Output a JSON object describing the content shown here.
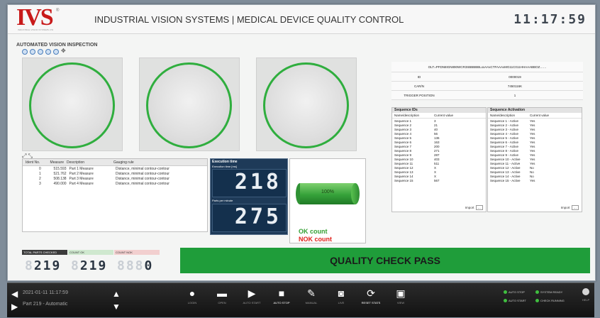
{
  "header": {
    "logo_text": "IVS",
    "logo_reg": "®",
    "logo_sub": "INDUSTRIAL VISION SYSTEMS LTD",
    "title": "INDUSTRIAL VISION SYSTEMS | MEDICAL DEVICE QUALITY CONTROL",
    "clock": "11:17:59"
  },
  "inspection": {
    "section_title": "AUTOMATED VISION INSPECTION",
    "toolbar_icons": [
      "zoom-in-icon",
      "zoom-out-icon",
      "zoom-fit-icon",
      "zoom-reset-icon",
      "refresh-icon",
      "pan-icon"
    ]
  },
  "measure_table": {
    "headers": [
      "Ident No.",
      "Measure",
      "Description",
      "Gauging rule"
    ],
    "rows": [
      [
        "0",
        "515.593",
        "Part 1 Measure",
        "Distance, minimal contour-contour"
      ],
      [
        "1",
        "521.762",
        "Part 2 Measure",
        "Distance, minimal contour-contour"
      ],
      [
        "2",
        "508.138",
        "Part 3 Measure",
        "Distance, minimal contour-contour"
      ],
      [
        "3",
        "490.000",
        "Part 4 Measure",
        "Distance, minimal contour-contour"
      ]
    ]
  },
  "execution": {
    "title": "Execution time",
    "exec_label": "Execution time [ms]",
    "exec_value": "218",
    "ppm_label": "Parts per minute",
    "ppm_value": "275"
  },
  "status": {
    "progress_label": "100%",
    "progress_fraction": 1.0,
    "ok_label": "OK count",
    "nok_label": "NOK count"
  },
  "info": {
    "code": "OLT=PFDN8IGN890WCR3SBBBBBLxxAAxCTFAAAxMG11C011HHAAABBOZ……",
    "rows": [
      {
        "key": "ID",
        "value": "0000019"
      },
      {
        "key": "CAR/N",
        "value": "7450116K"
      },
      {
        "key": "TRIGGER POSITION",
        "value": "1"
      }
    ]
  },
  "sequence_ids": {
    "title": "Sequence IDs",
    "headers": [
      "Name/description",
      "Current value"
    ],
    "rows": [
      [
        "Sequence 1",
        "3"
      ],
      [
        "Sequence 2",
        "21"
      ],
      [
        "Sequence 3",
        "40"
      ],
      [
        "Sequence 4",
        "56"
      ],
      [
        "Sequence 5",
        "136"
      ],
      [
        "Sequence 6",
        "163"
      ],
      [
        "Sequence 7",
        "200"
      ],
      [
        "Sequence 8",
        "271"
      ],
      [
        "Sequence 9",
        "287"
      ],
      [
        "Sequence 10",
        "403"
      ],
      [
        "Sequence 11",
        "511"
      ],
      [
        "Sequence 12",
        "X"
      ],
      [
        "Sequence 13",
        "X"
      ],
      [
        "Sequence 14",
        "X"
      ],
      [
        "Sequence 15",
        "567"
      ]
    ],
    "import_label": "Import"
  },
  "sequence_activation": {
    "title": "Sequence Activation",
    "headers": [
      "Name/description",
      "Current value"
    ],
    "rows": [
      [
        "Sequence 1 - Active",
        "Yes"
      ],
      [
        "Sequence 2 - Active",
        "Yes"
      ],
      [
        "Sequence 3 - Active",
        "Yes"
      ],
      [
        "Sequence 4 - Active",
        "Yes"
      ],
      [
        "Sequence 5 - Active",
        "Yes"
      ],
      [
        "Sequence 6 - Active",
        "Yes"
      ],
      [
        "Sequence 7 - Active",
        "Yes"
      ],
      [
        "Sequence 8 - Active",
        "Yes"
      ],
      [
        "Sequence 9 - Active",
        "Yes"
      ],
      [
        "Sequence 10 - Active",
        "Yes"
      ],
      [
        "Sequence 11 - Active",
        "Yes"
      ],
      [
        "Sequence 12 - Active",
        "No"
      ],
      [
        "Sequence 13 - Active",
        "No"
      ],
      [
        "Sequence 14 - Active",
        "No"
      ],
      [
        "Sequence 15 - Active",
        "Yes"
      ]
    ],
    "import_label": "Import"
  },
  "counters": {
    "total_label": "TOTAL PARTS CHECKED",
    "total_ghost": "8",
    "total_value": "219",
    "ok_label": "COUNT OK",
    "ok_ghost": "8",
    "ok_value": "219",
    "nok_label": "COUNT NOK",
    "nok_ghost": "888",
    "nok_value": "0",
    "colors": {
      "total": "#3b3b3b",
      "ok": "#cfe8cf",
      "nok": "#f2cfcf"
    }
  },
  "result": {
    "text": "QUALITY CHECK PASS",
    "color": "#1f9d3a"
  },
  "taskbar": {
    "line1": "2021-01-11 11:17:59",
    "line2": "Part 219 - Automatic",
    "items": [
      {
        "name": "login",
        "label": "LOGIN",
        "icon": "user-icon"
      },
      {
        "name": "open",
        "label": "OPEN",
        "icon": "folder-icon"
      },
      {
        "name": "auto-start",
        "label": "AUTO START",
        "icon": "play-icon"
      },
      {
        "name": "auto-stop",
        "label": "AUTO STOP",
        "icon": "stop-icon"
      },
      {
        "name": "manual",
        "label": "MANUAL",
        "icon": "wrench-icon"
      },
      {
        "name": "live",
        "label": "LIVE",
        "icon": "camera-icon"
      },
      {
        "name": "reset-stats",
        "label": "RESET STATS",
        "icon": "reset-icon"
      },
      {
        "name": "view",
        "label": "VIEW",
        "icon": "monitor-icon"
      }
    ],
    "status": {
      "auto_stop": "AUTO STOP",
      "system_ready": "SYSTEM READY",
      "auto_start": "AUTO START",
      "check_running": "CHECK RUNNING"
    },
    "help_label": "HELP"
  }
}
